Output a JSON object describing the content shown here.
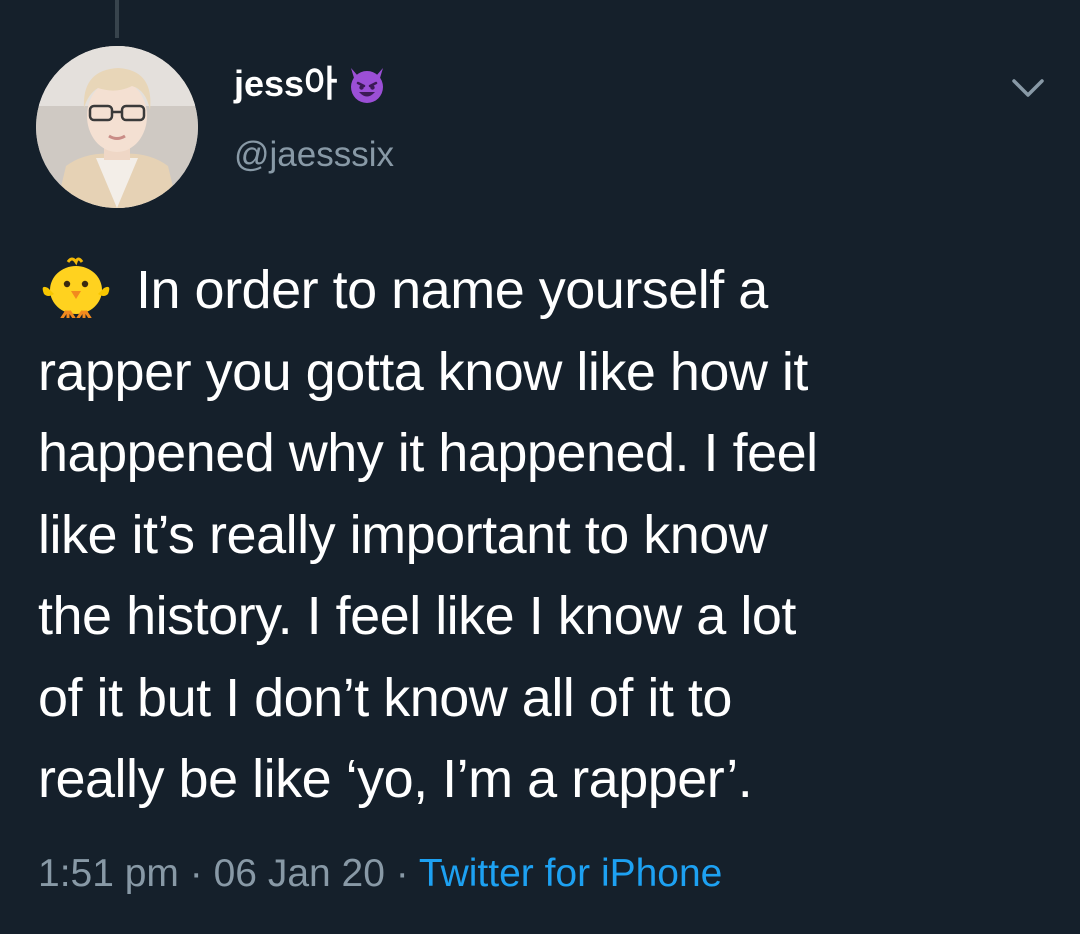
{
  "tweet": {
    "author": {
      "display_name": "jess아",
      "name_emoji": "smiling-devil-icon",
      "handle": "@jaesssix"
    },
    "lead_emoji": "front-facing-chick-icon",
    "lines": [
      "In order to name yourself a",
      "rapper you gotta know like how it",
      "happened why it happened. I feel",
      "like it’s really important to know",
      "the history. I feel like I know a lot",
      "of it but I don’t know all of it to",
      "really be like ‘yo, I’m a rapper’."
    ],
    "time": "1:51 pm",
    "separator": "·",
    "date": "06 Jan 20",
    "source": "Twitter for iPhone"
  },
  "colors": {
    "background": "#15202b",
    "text_primary": "#ffffff",
    "text_secondary": "#8899a6",
    "link": "#1da1f2",
    "devil_purple": "#9b4fd6"
  }
}
